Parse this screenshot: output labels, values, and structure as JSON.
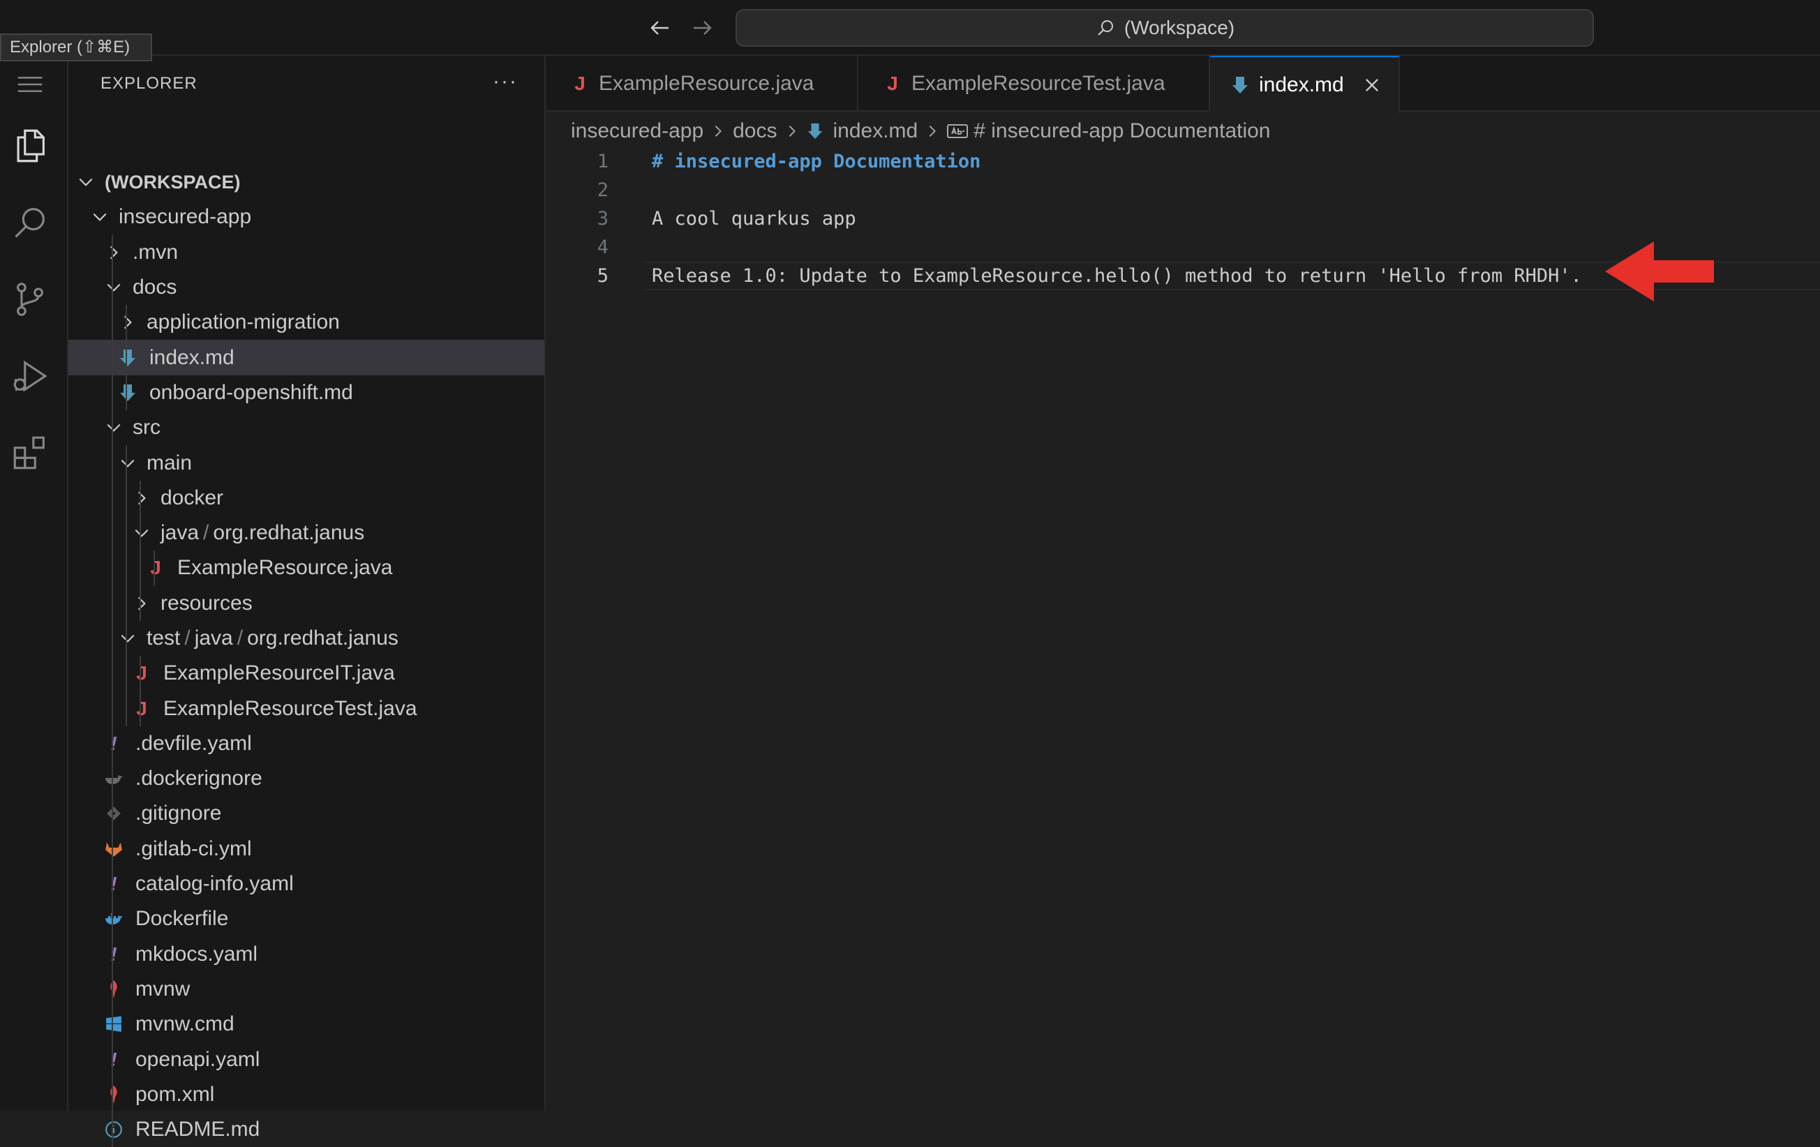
{
  "tooltip": "Explorer (⇧⌘E)",
  "command_center": {
    "label": "(Workspace)"
  },
  "sidebar": {
    "title": "EXPLORER",
    "more": "···",
    "tree": [
      {
        "label": "(WORKSPACE)",
        "indent": 0,
        "type": "folder-open",
        "bold": true
      },
      {
        "label": "insecured-app",
        "indent": 1,
        "type": "folder-open"
      },
      {
        "label": ".mvn",
        "indent": 2,
        "type": "folder"
      },
      {
        "label": "docs",
        "indent": 2,
        "type": "folder-open"
      },
      {
        "label": "application-migration",
        "indent": 3,
        "type": "folder"
      },
      {
        "label": "index.md",
        "indent": 3,
        "type": "md",
        "selected": true
      },
      {
        "label": "onboard-openshift.md",
        "indent": 3,
        "type": "md"
      },
      {
        "label": "src",
        "indent": 2,
        "type": "folder-open"
      },
      {
        "label": "main",
        "indent": 3,
        "type": "folder-open"
      },
      {
        "label": "docker",
        "indent": 4,
        "type": "folder"
      },
      {
        "label": "java",
        "label2": "org.redhat.janus",
        "indent": 4,
        "type": "folder-open"
      },
      {
        "label": "ExampleResource.java",
        "indent": 5,
        "type": "java"
      },
      {
        "label": "resources",
        "indent": 4,
        "type": "folder"
      },
      {
        "label": "test",
        "label2": "java",
        "label3": "org.redhat.janus",
        "indent": 3,
        "type": "folder-open"
      },
      {
        "label": "ExampleResourceIT.java",
        "indent": 4,
        "type": "java"
      },
      {
        "label": "ExampleResourceTest.java",
        "indent": 4,
        "type": "java"
      },
      {
        "label": ".devfile.yaml",
        "indent": 2,
        "type": "yaml"
      },
      {
        "label": ".dockerignore",
        "indent": 2,
        "type": "dockerignore"
      },
      {
        "label": ".gitignore",
        "indent": 2,
        "type": "git"
      },
      {
        "label": ".gitlab-ci.yml",
        "indent": 2,
        "type": "gitlab"
      },
      {
        "label": "catalog-info.yaml",
        "indent": 2,
        "type": "yaml"
      },
      {
        "label": "Dockerfile",
        "indent": 2,
        "type": "docker"
      },
      {
        "label": "mkdocs.yaml",
        "indent": 2,
        "type": "yaml"
      },
      {
        "label": "mvnw",
        "indent": 2,
        "type": "maven"
      },
      {
        "label": "mvnw.cmd",
        "indent": 2,
        "type": "windows"
      },
      {
        "label": "openapi.yaml",
        "indent": 2,
        "type": "yaml"
      },
      {
        "label": "pom.xml",
        "indent": 2,
        "type": "maven"
      },
      {
        "label": "README.md",
        "indent": 2,
        "type": "info"
      }
    ]
  },
  "tabs": [
    {
      "label": "ExampleResource.java",
      "icon": "java",
      "active": false
    },
    {
      "label": "ExampleResourceTest.java",
      "icon": "java",
      "active": false
    },
    {
      "label": "index.md",
      "icon": "md",
      "active": true
    }
  ],
  "breadcrumb": {
    "items": [
      "insecured-app",
      "docs",
      "index.md",
      "# insecured-app Documentation"
    ]
  },
  "editor": {
    "current_line": 5,
    "lines": [
      {
        "no": "1",
        "text": "# insecured-app Documentation",
        "style": "heading"
      },
      {
        "no": "2",
        "text": ""
      },
      {
        "no": "3",
        "text": "A cool quarkus app"
      },
      {
        "no": "4",
        "text": ""
      },
      {
        "no": "5",
        "text": "Release 1.0: Update to ExampleResource.hello() method to return 'Hello from RHDH'."
      }
    ]
  },
  "colors": {
    "java": "#e05252",
    "md": "#519aba",
    "yaml": "#a074c4",
    "docker": "#3f9bd5",
    "gitlab": "#e2763a",
    "maven": "#e04646",
    "info": "#519aba",
    "annotation_arrow": "#e8302a"
  }
}
